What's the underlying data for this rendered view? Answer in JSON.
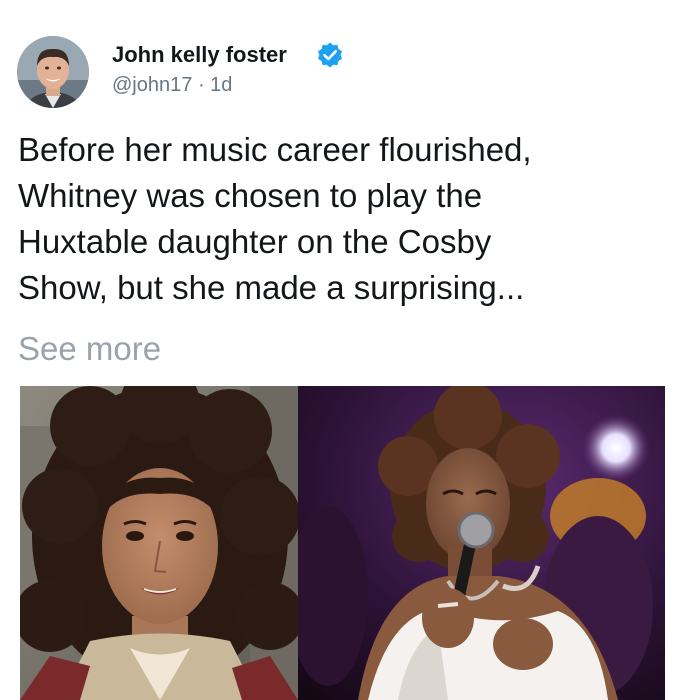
{
  "tweet": {
    "author": {
      "name": "John kelly foster",
      "handle": "@john17",
      "time": "1d",
      "verified": true,
      "separator": "·"
    },
    "text_lines": [
      "Before her music career flourished,",
      "Whitney was chosen to play the",
      "Huxtable daughter on the Cosby",
      "Show, but she made a surprising..."
    ],
    "see_more": "See more",
    "media": [
      {
        "kind": "photo",
        "icon": "portrait-photo"
      },
      {
        "kind": "photo",
        "icon": "concert-photo"
      }
    ]
  },
  "colors": {
    "text": "#14171a",
    "secondary": "#657786",
    "see_more": "#9aa3ab",
    "verified": "#1da1f2"
  }
}
